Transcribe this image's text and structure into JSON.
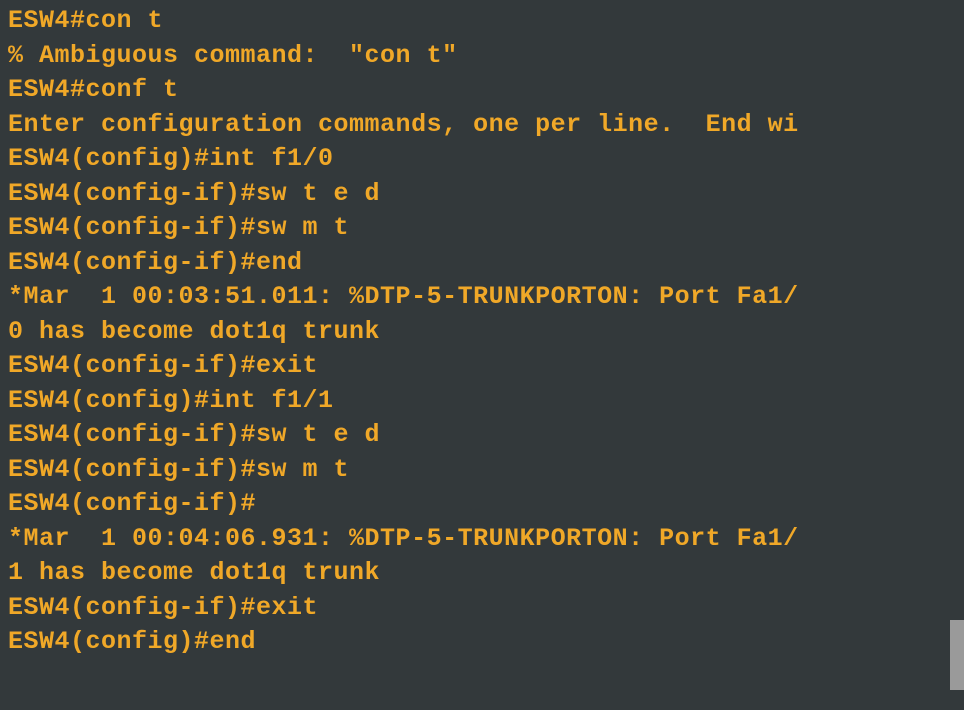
{
  "terminal": {
    "lines": [
      "ESW4#con t",
      "% Ambiguous command:  \"con t\"",
      "ESW4#conf t",
      "Enter configuration commands, one per line.  End wi",
      "ESW4(config)#int f1/0",
      "ESW4(config-if)#sw t e d",
      "ESW4(config-if)#sw m t",
      "ESW4(config-if)#end",
      "*Mar  1 00:03:51.011: %DTP-5-TRUNKPORTON: Port Fa1/",
      "0 has become dot1q trunk",
      "ESW4(config-if)#exit",
      "ESW4(config)#int f1/1",
      "ESW4(config-if)#sw t e d",
      "ESW4(config-if)#sw m t",
      "ESW4(config-if)#",
      "*Mar  1 00:04:06.931: %DTP-5-TRUNKPORTON: Port Fa1/",
      "1 has become dot1q trunk",
      "ESW4(config-if)#exit",
      "ESW4(config)#end"
    ]
  }
}
